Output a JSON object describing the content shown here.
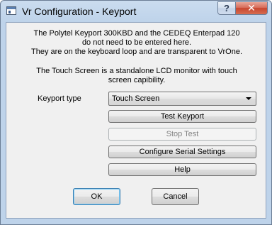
{
  "window": {
    "title": "Vr Configuration - Keyport",
    "help_glyph": "?",
    "close_glyph": "✕"
  },
  "info": {
    "line1": "The Polytel Keyport 300KBD and the CEDEQ Enterpad 120",
    "line2": "do not need to be entered here.",
    "line3": "They are on the keyboard loop and are transparent to VrOne.",
    "line4": "The Touch Screen is a standalone LCD monitor with touch",
    "line5": "screen capibility."
  },
  "keyport": {
    "label": "Keyport type",
    "selected": "Touch Screen"
  },
  "buttons": {
    "test": "Test Keyport",
    "stop": "Stop Test",
    "serial": "Configure Serial Settings",
    "help": "Help",
    "ok": "OK",
    "cancel": "Cancel"
  },
  "colors": {
    "client_bg": "#f0f0f0",
    "frame": "#bed3ea",
    "close": "#c7462f"
  }
}
